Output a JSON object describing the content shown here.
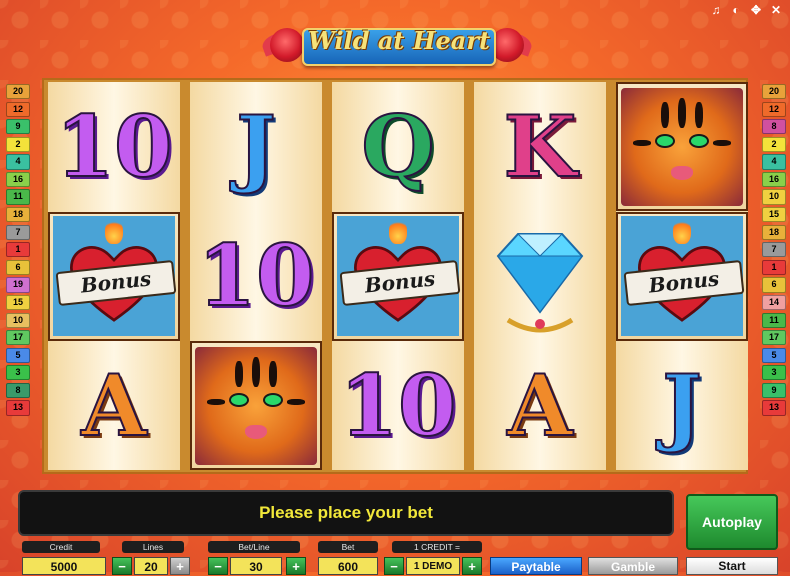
{
  "title": "Wild at Heart",
  "top_icons": [
    "music-icon",
    "speaker-icon",
    "fullscreen-icon",
    "close-icon"
  ],
  "paylines_left": [
    {
      "n": "20",
      "color": "#e8a23a"
    },
    {
      "n": "12",
      "color": "#ef6a2a"
    },
    {
      "n": "9",
      "color": "#3ac06a"
    },
    {
      "n": "2",
      "color": "#f3e23a"
    },
    {
      "n": "4",
      "color": "#3ac0a0"
    },
    {
      "n": "16",
      "color": "#8ad04a"
    },
    {
      "n": "11",
      "color": "#4ab84a"
    },
    {
      "n": "18",
      "color": "#e8b03a"
    },
    {
      "n": "7",
      "color": "#9a9a9a"
    },
    {
      "n": "1",
      "color": "#e83a3a"
    },
    {
      "n": "6",
      "color": "#e8c23a"
    },
    {
      "n": "19",
      "color": "#d070d0"
    },
    {
      "n": "15",
      "color": "#f0d040"
    },
    {
      "n": "10",
      "color": "#e8c060"
    },
    {
      "n": "17",
      "color": "#60c860"
    },
    {
      "n": "5",
      "color": "#4a8ae8"
    },
    {
      "n": "3",
      "color": "#3ac04a"
    },
    {
      "n": "8",
      "color": "#3a9a6a"
    },
    {
      "n": "13",
      "color": "#e83a3a"
    }
  ],
  "paylines_right": [
    {
      "n": "20",
      "color": "#e8a23a"
    },
    {
      "n": "12",
      "color": "#ef6a2a"
    },
    {
      "n": "8",
      "color": "#d050a0"
    },
    {
      "n": "2",
      "color": "#f3e23a"
    },
    {
      "n": "4",
      "color": "#3ac0a0"
    },
    {
      "n": "16",
      "color": "#8ad04a"
    },
    {
      "n": "10",
      "color": "#f0d040"
    },
    {
      "n": "15",
      "color": "#f0d040"
    },
    {
      "n": "18",
      "color": "#e8b03a"
    },
    {
      "n": "7",
      "color": "#9a9a9a"
    },
    {
      "n": "1",
      "color": "#e83a3a"
    },
    {
      "n": "6",
      "color": "#e8c23a"
    },
    {
      "n": "14",
      "color": "#f0a0a0"
    },
    {
      "n": "11",
      "color": "#4ab84a"
    },
    {
      "n": "17",
      "color": "#60c860"
    },
    {
      "n": "5",
      "color": "#4a8ae8"
    },
    {
      "n": "3",
      "color": "#3ac04a"
    },
    {
      "n": "9",
      "color": "#3ac06a"
    },
    {
      "n": "13",
      "color": "#e83a3a"
    }
  ],
  "reels": [
    [
      "10",
      "bonus",
      "A"
    ],
    [
      "J",
      "10",
      "tiger"
    ],
    [
      "Q",
      "bonus",
      "10"
    ],
    [
      "K",
      "diamond",
      "A"
    ],
    [
      "tiger",
      "bonus",
      "J"
    ]
  ],
  "bonus_label": "Bonus",
  "message": "Please place your bet",
  "autoplay_label": "Autoplay",
  "controls": {
    "credit_label": "Credit",
    "credit_value": "5000",
    "lines_label": "Lines",
    "lines_value": "20",
    "betline_label": "Bet/Line",
    "betline_value": "30",
    "bet_label": "Bet",
    "bet_value": "600",
    "credit_eq_label": "1 CREDIT =",
    "credit_eq_value": "1 DEMO",
    "paytable_label": "Paytable",
    "gamble_label": "Gamble",
    "start_label": "Start"
  }
}
